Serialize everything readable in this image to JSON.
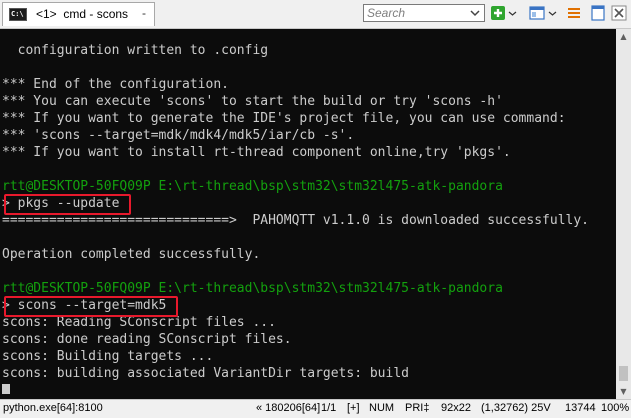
{
  "titlebar": {
    "tab_icon_text": "C:\\",
    "tab_label": "<1>  cmd - scons",
    "tab_menu": "-",
    "search_placeholder": "Search"
  },
  "terminal": {
    "lines": [
      "",
      "  configuration written to .config",
      "",
      "*** End of the configuration.",
      "*** You can execute 'scons' to start the build or try 'scons -h'",
      "*** If you want to generate the IDE's project file, you can use command:",
      "*** 'scons --target=mdk/mdk4/mdk5/iar/cb -s'.",
      "*** If you want to install rt-thread component online,try 'pkgs'.",
      "",
      "rtt@DESKTOP-50FQ09P E:\\rt-thread\\bsp\\stm32\\stm32l475-atk-pandora",
      "> pkgs --update",
      "=============================>  PAHOMQTT v1.1.0 is downloaded successfully.",
      "",
      "Operation completed successfully.",
      "",
      "rtt@DESKTOP-50FQ09P E:\\rt-thread\\bsp\\stm32\\stm32l475-atk-pandora",
      "> scons --target=mdk5",
      "scons: Reading SConscript files ...",
      "scons: done reading SConscript files.",
      "scons: Building targets ...",
      "scons: building associated VariantDir targets: build"
    ]
  },
  "statusbar": {
    "process": "python.exe[64]:8100",
    "position": "« 180206[64]",
    "pages": "1/1",
    "insert": "[+]",
    "num": "NUM",
    "pri": "PRI‡",
    "size": "92x22",
    "coords": "(1,32762) 25V",
    "memory": "13744",
    "zoom": "100%"
  }
}
